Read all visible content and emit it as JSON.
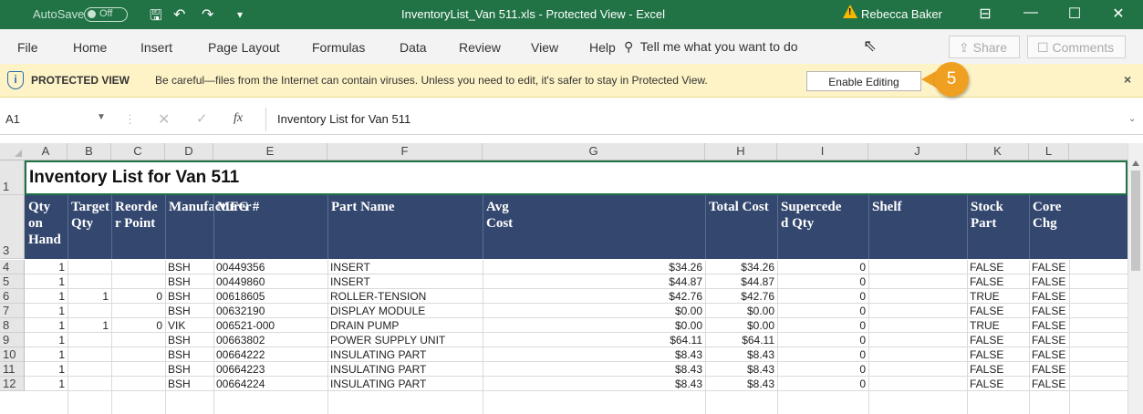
{
  "titlebar": {
    "autosave_label": "AutoSave",
    "autosave_state": "Off",
    "window_title": "InventoryList_Van 511.xls  -  Protected View  -  Excel",
    "user_name": "Rebecca Baker",
    "warning_glyph": "!"
  },
  "ribbon": {
    "tabs": [
      "File",
      "Home",
      "Insert",
      "Page Layout",
      "Formulas",
      "Data",
      "Review",
      "View",
      "Help"
    ],
    "tell_me": "Tell me what you want to do",
    "share_label": "Share",
    "comments_label": "Comments"
  },
  "protected_view": {
    "label": "PROTECTED VIEW",
    "message": "Be careful—files from the Internet can contain viruses. Unless you need to edit, it's safer to stay in Protected View.",
    "enable_label": "Enable Editing",
    "close_glyph": "×",
    "info_glyph": "i"
  },
  "callout": {
    "number": "5",
    "color": "#f0a020"
  },
  "formula_bar": {
    "cell_ref": "A1",
    "fx_label": "fx",
    "content": "Inventory List for Van 511"
  },
  "sheet": {
    "columns": [
      "A",
      "B",
      "C",
      "D",
      "E",
      "F",
      "G",
      "H",
      "I",
      "J",
      "K",
      "L"
    ],
    "row_numbers": [
      "1",
      "3",
      "4",
      "5",
      "6",
      "7",
      "8",
      "9",
      "10",
      "11",
      "12"
    ],
    "title": "Inventory List for Van 511",
    "header_fill": "#34486f",
    "headers": [
      [
        "Qty on",
        "Hand"
      ],
      [
        "Target",
        "Qty"
      ],
      [
        "Reorde",
        "r Point"
      ],
      [
        "Manufacturer",
        ""
      ],
      [
        "MFG #",
        ""
      ],
      [
        "Part Name",
        ""
      ],
      [
        "Avg",
        "Cost"
      ],
      [
        "Total Cost",
        ""
      ],
      [
        "Supercede",
        "d Qty"
      ],
      [
        "Shelf",
        ""
      ],
      [
        "Stock",
        "Part"
      ],
      [
        "Core",
        "Chg"
      ]
    ],
    "rows": [
      [
        "1",
        "",
        "",
        "BSH",
        "00449356",
        "INSERT",
        "$34.26",
        "$34.26",
        "0",
        "",
        "FALSE",
        "FALSE"
      ],
      [
        "1",
        "",
        "",
        "BSH",
        "00449860",
        "INSERT",
        "$44.87",
        "$44.87",
        "0",
        "",
        "FALSE",
        "FALSE"
      ],
      [
        "1",
        "1",
        "0",
        "BSH",
        "00618605",
        "ROLLER-TENSION",
        "$42.76",
        "$42.76",
        "0",
        "",
        "TRUE",
        "FALSE"
      ],
      [
        "1",
        "",
        "",
        "BSH",
        "00632190",
        "DISPLAY MODULE",
        "$0.00",
        "$0.00",
        "0",
        "",
        "FALSE",
        "FALSE"
      ],
      [
        "1",
        "1",
        "0",
        "VIK",
        "006521-000",
        "DRAIN PUMP",
        "$0.00",
        "$0.00",
        "0",
        "",
        "TRUE",
        "FALSE"
      ],
      [
        "1",
        "",
        "",
        "BSH",
        "00663802",
        "POWER SUPPLY UNIT",
        "$64.11",
        "$64.11",
        "0",
        "",
        "FALSE",
        "FALSE"
      ],
      [
        "1",
        "",
        "",
        "BSH",
        "00664222",
        "INSULATING PART",
        "$8.43",
        "$8.43",
        "0",
        "",
        "FALSE",
        "FALSE"
      ],
      [
        "1",
        "",
        "",
        "BSH",
        "00664223",
        "INSULATING PART",
        "$8.43",
        "$8.43",
        "0",
        "",
        "FALSE",
        "FALSE"
      ],
      [
        "1",
        "",
        "",
        "BSH",
        "00664224",
        "INSULATING PART",
        "$8.43",
        "$8.43",
        "0",
        "",
        "FALSE",
        "FALSE"
      ]
    ]
  }
}
